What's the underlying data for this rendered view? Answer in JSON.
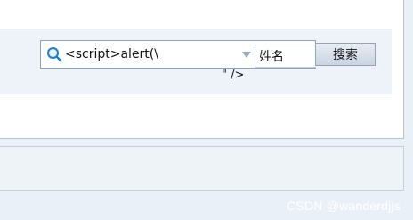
{
  "search": {
    "value": "<script>alert(\\",
    "field_selected": "姓名",
    "button_label": "搜索"
  },
  "overflow_text": "\" />",
  "watermark": "CSDN @wanderdjjs",
  "icons": {
    "search": "search-icon",
    "dropdown": "chevron-down-icon"
  },
  "colors": {
    "toolbar_bg": "#eef3fa",
    "page_bg": "#e9f0f7",
    "icon": "#1f7fc1"
  }
}
